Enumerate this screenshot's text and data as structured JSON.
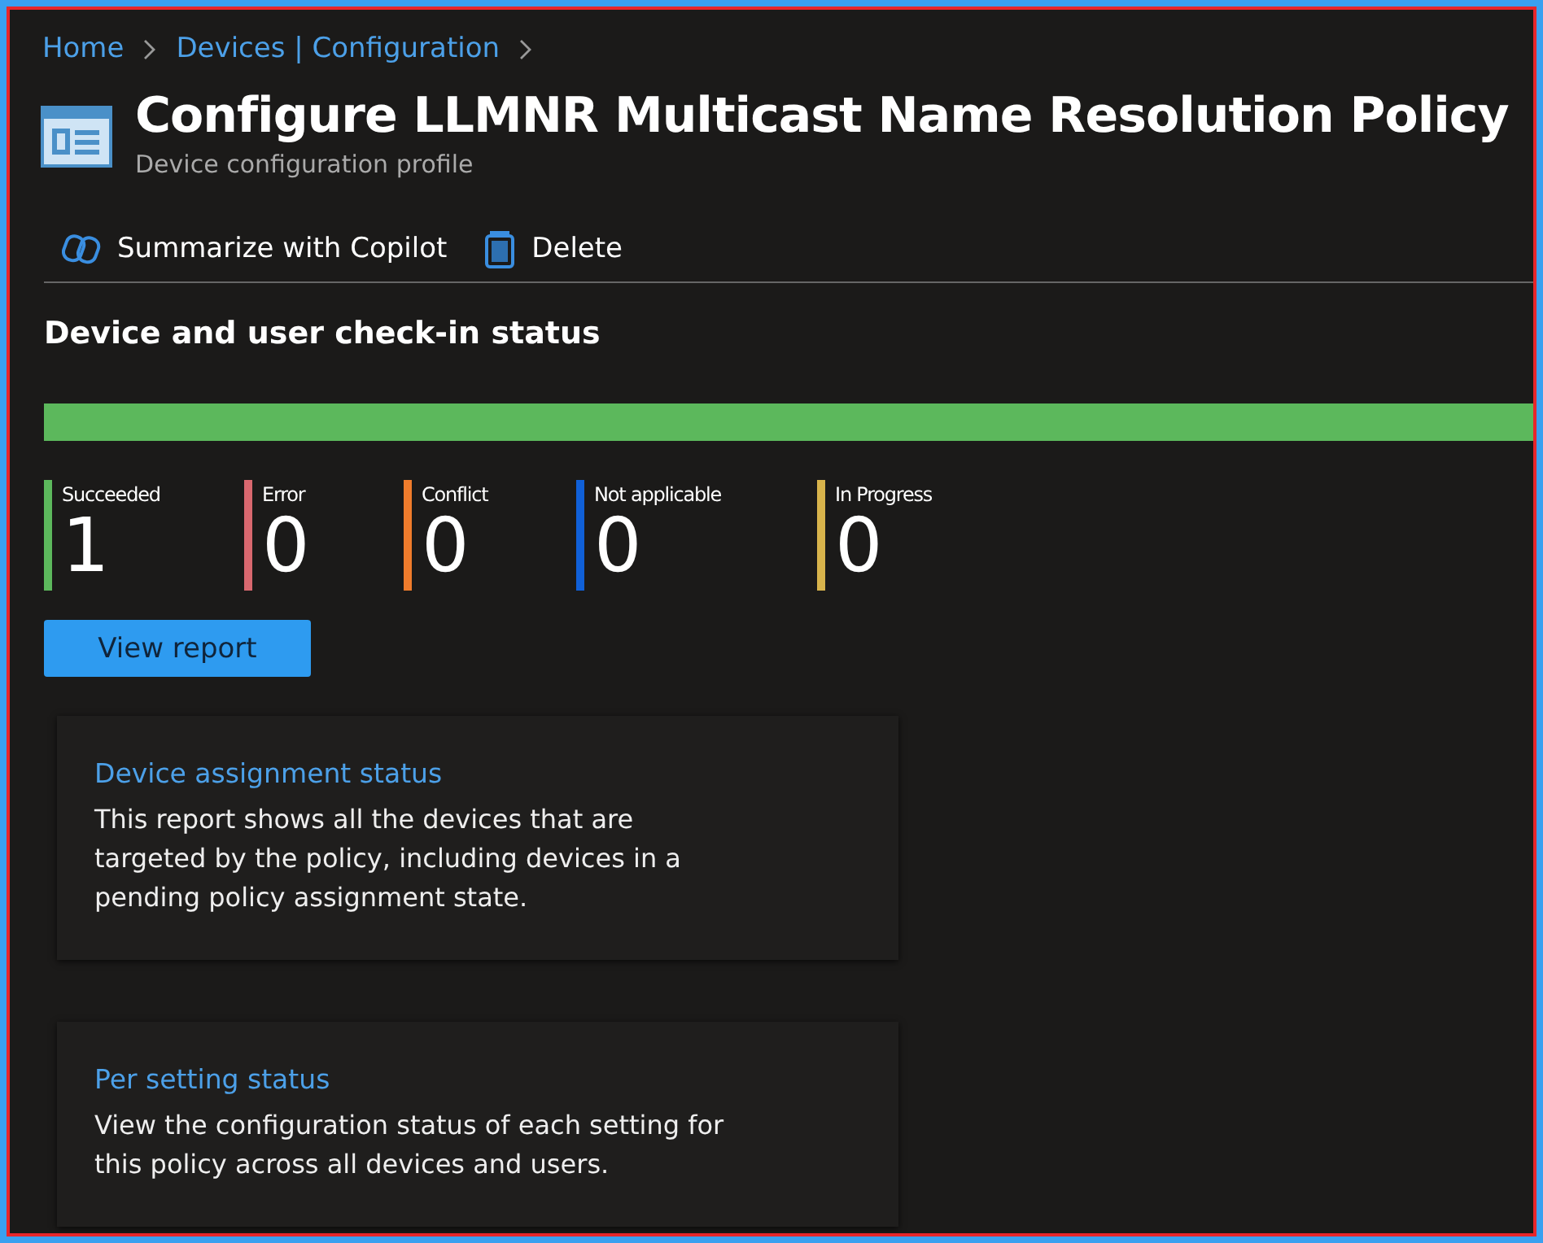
{
  "breadcrumb": [
    "Home",
    "Devices | Configuration"
  ],
  "title": "Configure LLMNR Multicast Name Resolution Policy",
  "subtitle": "Device configuration profile",
  "toolbar": [
    {
      "kind": "copilot",
      "label": "Summarize with Copilot"
    },
    {
      "kind": "delete",
      "label": "Delete"
    }
  ],
  "section_title": "Device and user check-in status",
  "status_bar": {
    "level": 1
  },
  "statuses": [
    {
      "label": "Succeeded",
      "count": "1",
      "color": "#5cb85c"
    },
    {
      "label": "Error",
      "count": "0",
      "color": "#d9686f"
    },
    {
      "label": "Conflict",
      "count": "0",
      "color": "#f07c2c"
    },
    {
      "label": "Not applicable",
      "count": "0",
      "color": "#1060d8"
    },
    {
      "label": "In Progress",
      "count": "0",
      "color": "#d8b44c"
    }
  ],
  "view_report_button": "View report",
  "cards": [
    {
      "title": "Device assignment status",
      "text": "This report shows all the devices that are targeted by the policy, including devices in a pending policy assignment state."
    },
    {
      "title": "Per setting status",
      "text": "View the configuration status of each setting for this policy across all devices and users."
    }
  ]
}
